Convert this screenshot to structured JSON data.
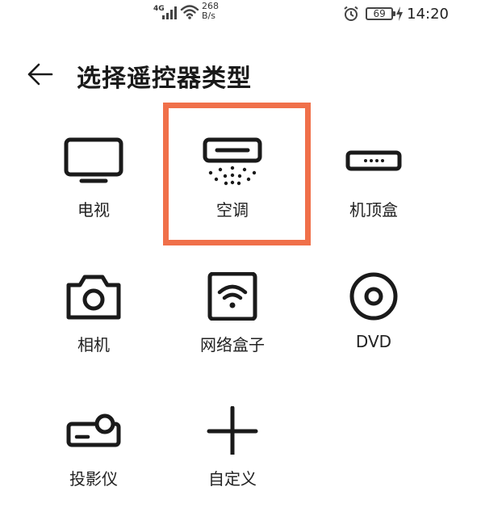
{
  "status_bar": {
    "network_type": "4G",
    "speed_value": "268",
    "speed_unit": "B/s",
    "battery": "69",
    "time": "14:20"
  },
  "header": {
    "title": "选择遥控器类型"
  },
  "devices": [
    {
      "label": "电视",
      "icon": "tv-icon"
    },
    {
      "label": "空调",
      "icon": "air-conditioner-icon"
    },
    {
      "label": "机顶盒",
      "icon": "set-top-box-icon"
    },
    {
      "label": "相机",
      "icon": "camera-icon"
    },
    {
      "label": "网络盒子",
      "icon": "network-box-icon"
    },
    {
      "label": "DVD",
      "icon": "disc-icon"
    },
    {
      "label": "投影仪",
      "icon": "projector-icon"
    },
    {
      "label": "自定义",
      "icon": "plus-icon"
    }
  ],
  "highlight": {
    "color": "#f0704a",
    "target": "空调"
  }
}
